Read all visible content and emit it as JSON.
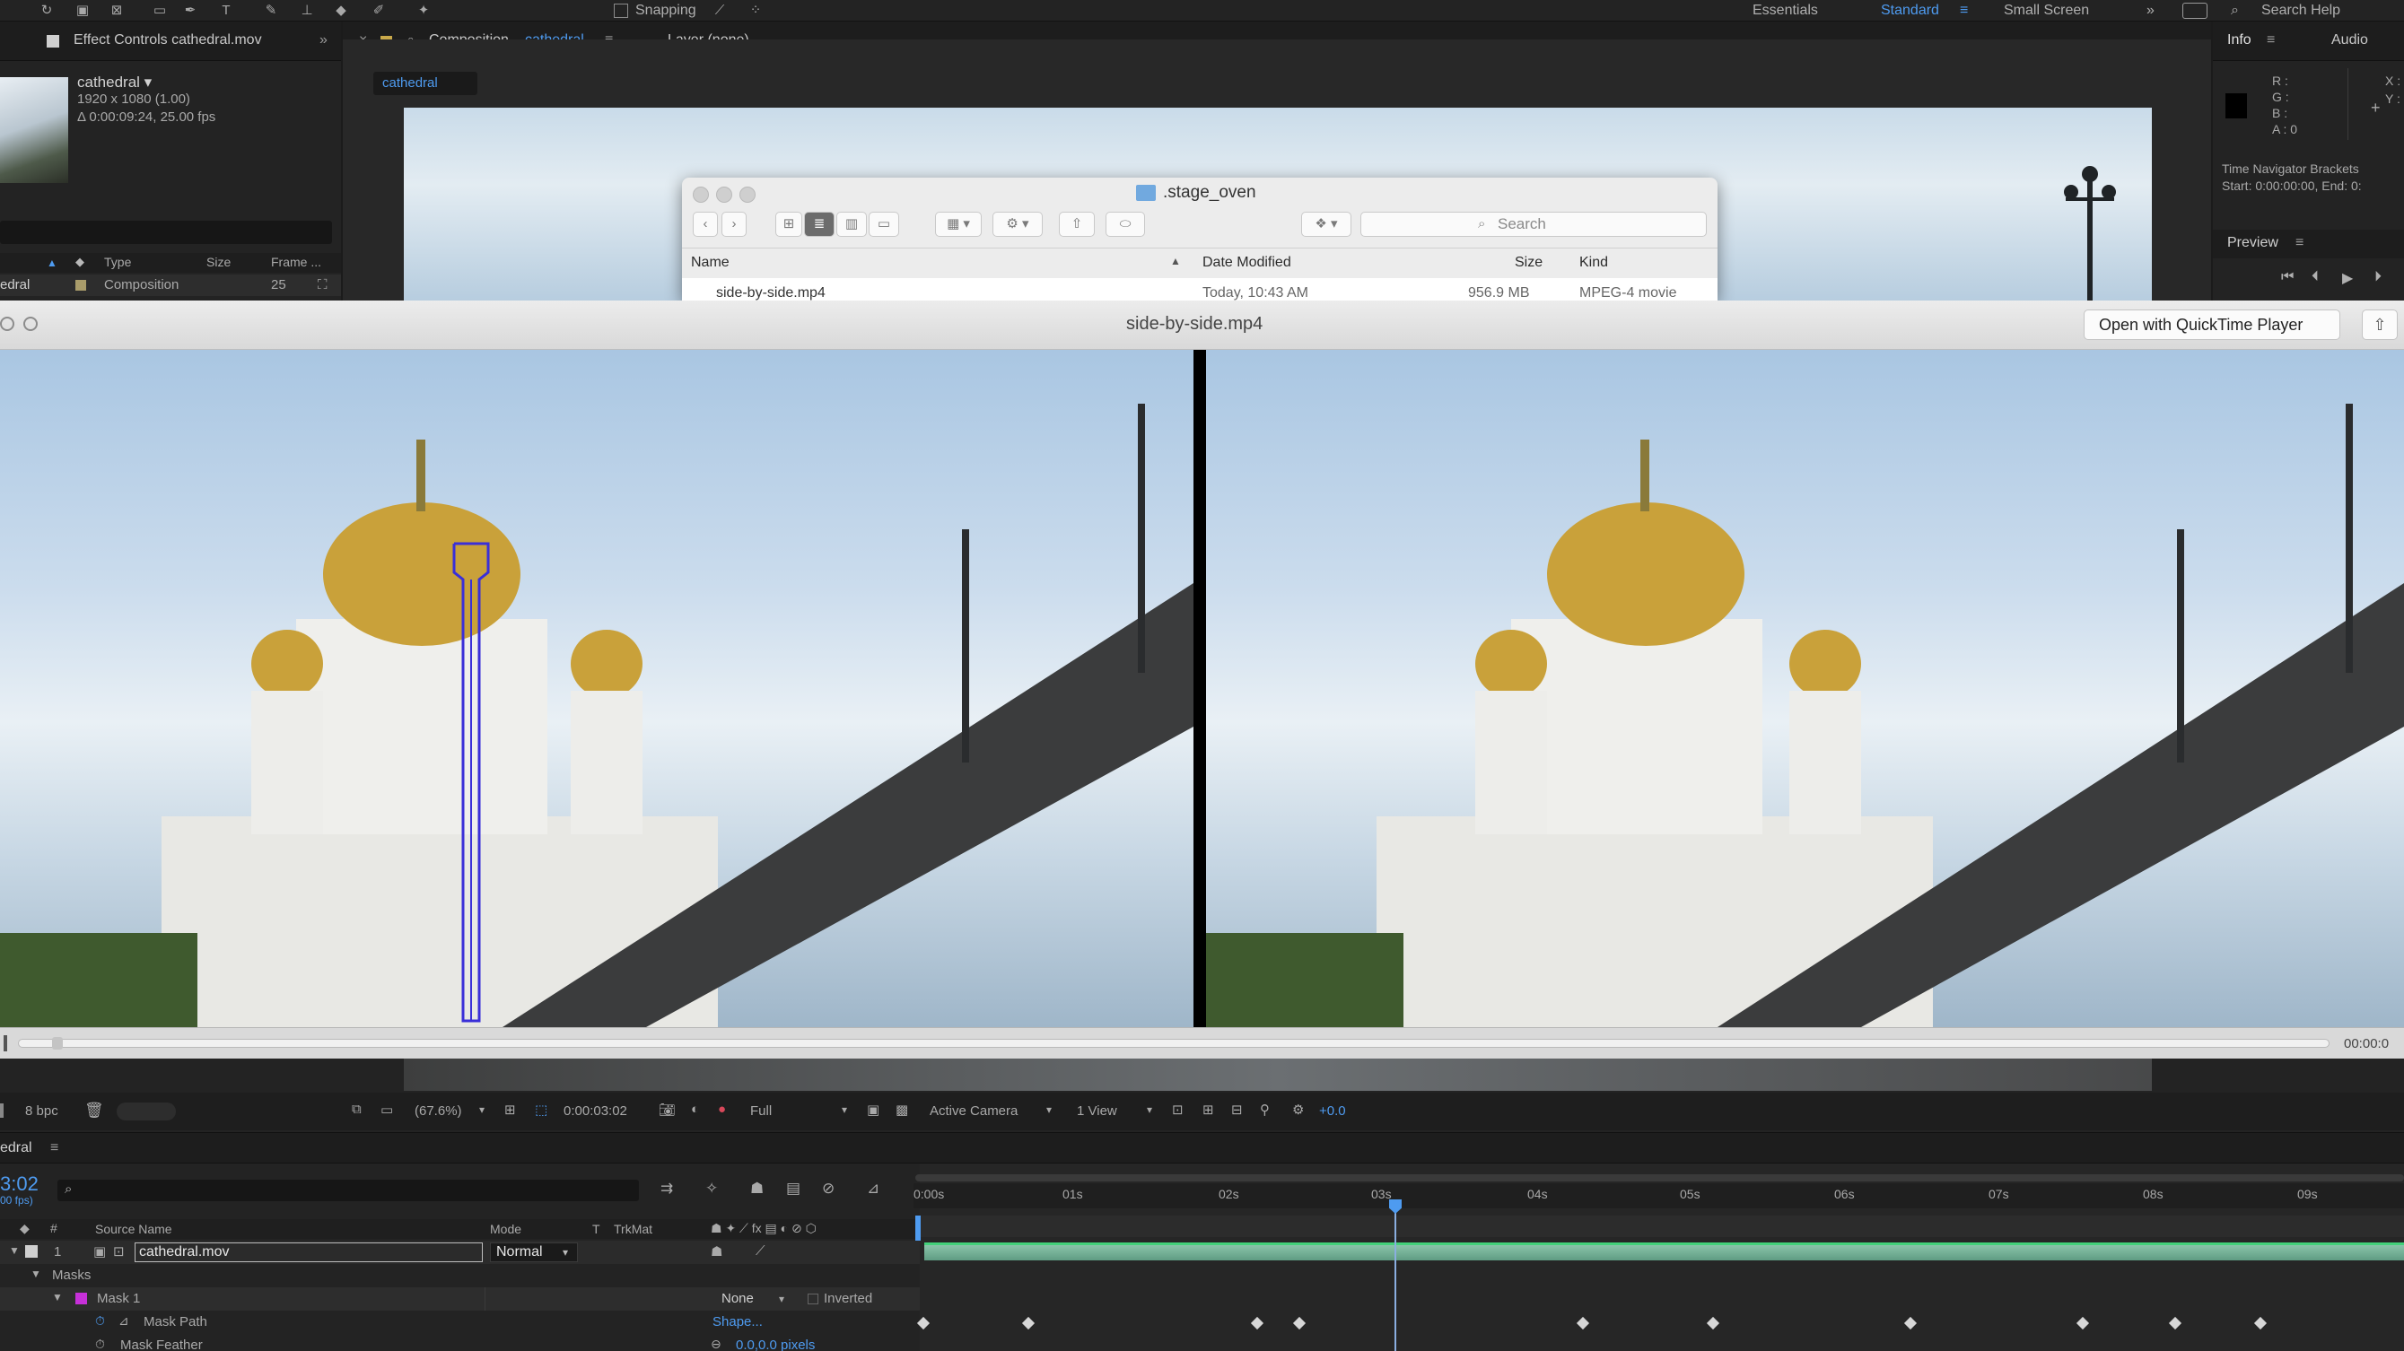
{
  "toolbar": {
    "snapping_label": "Snapping",
    "workspaces": [
      "Essentials",
      "Standard",
      "Small Screen"
    ],
    "search_help": "Search Help",
    "overflow": "»"
  },
  "project_panel": {
    "tab_title": "Effect Controls cathedral.mov",
    "item_name": "cathedral ▾",
    "item_dims": "1920 x 1080 (1.00)",
    "item_duration": "Δ 0:00:09:24, 25.00 fps",
    "columns": [
      "Type",
      "Size",
      "Frame ..."
    ],
    "row": {
      "name": "edral",
      "type": "Composition",
      "size": "25"
    },
    "bpc": "8 bpc"
  },
  "composition": {
    "tab_title": "Composition",
    "comp_name": "cathedral",
    "layer_tab": "Layer (none)",
    "sub_tab": "cathedral",
    "zoom": "(67.6%)",
    "timecode": "0:00:03:02",
    "resolution": "Full",
    "camera": "Active Camera",
    "views": "1 View",
    "exposure": "+0.0"
  },
  "right_panel": {
    "tabs": [
      "Info",
      "Audio"
    ],
    "rgba": [
      "R :",
      "G :",
      "B :",
      "A : 0"
    ],
    "xy": [
      "X :",
      "Y :"
    ],
    "nav_title": "Time Navigator Brackets",
    "nav_values": "Start: 0:00:00:00, End: 0:",
    "preview": "Preview"
  },
  "finder": {
    "folder": ".stage_oven",
    "search_placeholder": "Search",
    "columns": [
      "Name",
      "Date Modified",
      "Size",
      "Kind"
    ],
    "row": {
      "name": "side-by-side.mp4",
      "date": "Today, 10:43 AM",
      "size": "956.9 MB",
      "kind": "MPEG-4 movie"
    }
  },
  "quicklook": {
    "title": "side-by-side.mp4",
    "open_button": "Open with QuickTime Player",
    "end_time": "00:00:0"
  },
  "timeline": {
    "comp_tab": "edral",
    "current_time": "3:02",
    "fps": "00 fps)",
    "columns": [
      "Source Name",
      "Mode",
      "T",
      "TrkMat"
    ],
    "ticks": [
      "0:00s",
      "01s",
      "02s",
      "03s",
      "04s",
      "05s",
      "06s",
      "07s",
      "08s",
      "09s"
    ],
    "layer": {
      "index": "1",
      "name": "cathedral.mov",
      "mode": "Normal"
    },
    "masks_label": "Masks",
    "mask": {
      "name": "Mask 1",
      "mode": "None",
      "inverted": "Inverted"
    },
    "mask_path": {
      "name": "Mask Path",
      "value": "Shape..."
    },
    "mask_feather": {
      "name": "Mask Feather",
      "value": "0.0,0.0 pixels"
    }
  }
}
